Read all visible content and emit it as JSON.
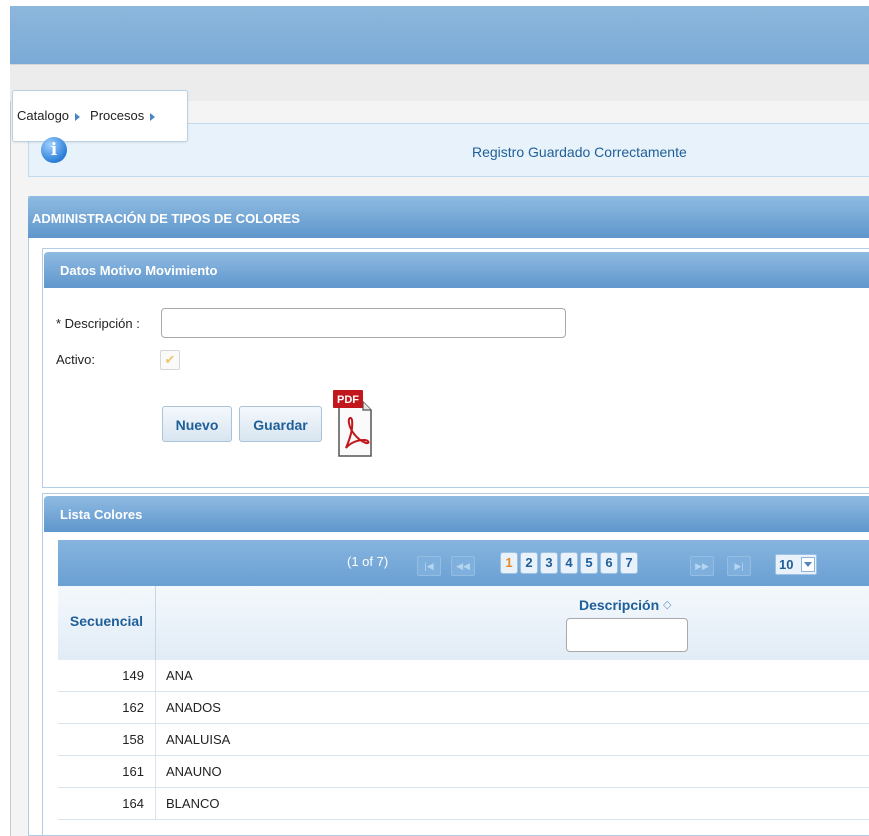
{
  "breadcrumb": {
    "items": [
      "Catalogo",
      "Procesos"
    ]
  },
  "message": {
    "icon": "info-icon",
    "text": "Registro Guardado Correctamente"
  },
  "panel": {
    "title": "ADMINISTRACIÓN DE TIPOS DE COLORES"
  },
  "form": {
    "title": "Datos Motivo Movimiento",
    "descripcion_label": "* Descripción :",
    "descripcion_value": "",
    "activo_label": "Activo:",
    "activo_checked": true,
    "nuevo_label": "Nuevo",
    "guardar_label": "Guardar",
    "pdf_label": "PDF"
  },
  "list": {
    "title": "Lista Colores",
    "paginator": {
      "current": "(1 of 7)",
      "pages": [
        "1",
        "2",
        "3",
        "4",
        "5",
        "6",
        "7"
      ],
      "active_page": "1",
      "rows_per_page": "10"
    },
    "columns": {
      "secuencial": "Secuencial",
      "descripcion": "Descripción"
    },
    "rows": [
      {
        "secuencial": "149",
        "descripcion": "ANA"
      },
      {
        "secuencial": "162",
        "descripcion": "ANADOS"
      },
      {
        "secuencial": "158",
        "descripcion": "ANALUISA"
      },
      {
        "secuencial": "161",
        "descripcion": "ANAUNO"
      },
      {
        "secuencial": "164",
        "descripcion": "BLANCO"
      }
    ]
  },
  "colors": {
    "header_blue": "#6fa3d4",
    "text_blue": "#1f5f99",
    "active_page": "#e38a2a"
  }
}
